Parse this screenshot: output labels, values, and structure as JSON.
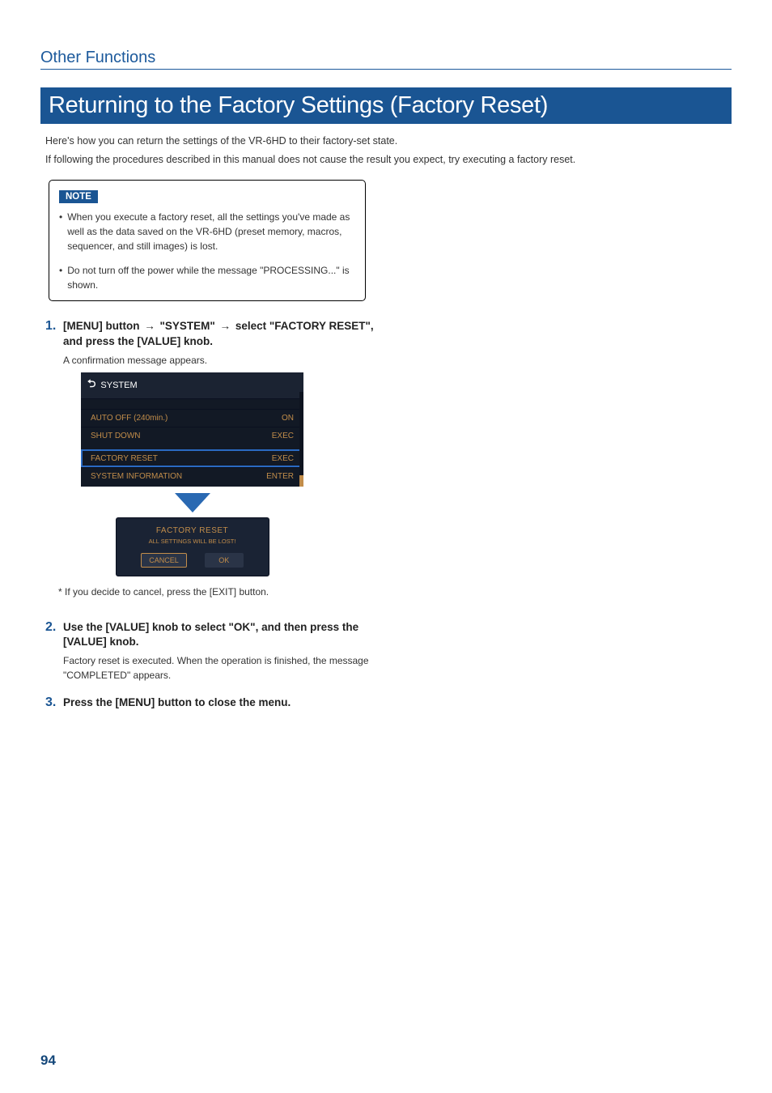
{
  "section_header": "Other Functions",
  "main_title": "Returning to the Factory Settings (Factory Reset)",
  "intro_lines": [
    "Here's how you can return the settings of the VR-6HD to their factory-set state.",
    "If following the procedures described in this manual does not cause the result you expect, try executing a factory reset."
  ],
  "note": {
    "badge": "NOTE",
    "items": [
      "When you execute a factory reset, all the settings you've made as well as the data saved on the VR-6HD (preset memory, macros, sequencer, and still images) is lost.",
      "Do not turn off the power while the message \"PROCESSING...\" is shown."
    ]
  },
  "steps": [
    {
      "num": "1.",
      "title_parts": {
        "p1": "[MENU] button ",
        "p2": " \"SYSTEM\" ",
        "p3": " select \"FACTORY RESET\", and press the [VALUE] knob."
      },
      "desc": "A confirmation message appears."
    },
    {
      "num": "2.",
      "title": "Use the [VALUE] knob to select \"OK\", and then press the [VALUE] knob.",
      "desc": "Factory reset is executed. When the operation is finished, the message \"COMPLETED\" appears."
    },
    {
      "num": "3.",
      "title": "Press the [MENU] button to close the menu.",
      "desc": ""
    }
  ],
  "footnote": "* If you decide to cancel, press the [EXIT] button.",
  "screenshot": {
    "header": "SYSTEM",
    "rows": [
      {
        "label": "AUTO OFF  (240min.)",
        "value": "ON"
      },
      {
        "label": "SHUT DOWN",
        "value": "EXEC"
      },
      {
        "label": "FACTORY RESET",
        "value": "EXEC",
        "highlight": true
      },
      {
        "label": "SYSTEM INFORMATION",
        "value": "ENTER"
      }
    ],
    "dialog": {
      "title": "FACTORY RESET",
      "sub": "ALL SETTINGS WILL BE LOST!",
      "cancel": "CANCEL",
      "ok": "OK"
    }
  },
  "page_number": "94"
}
